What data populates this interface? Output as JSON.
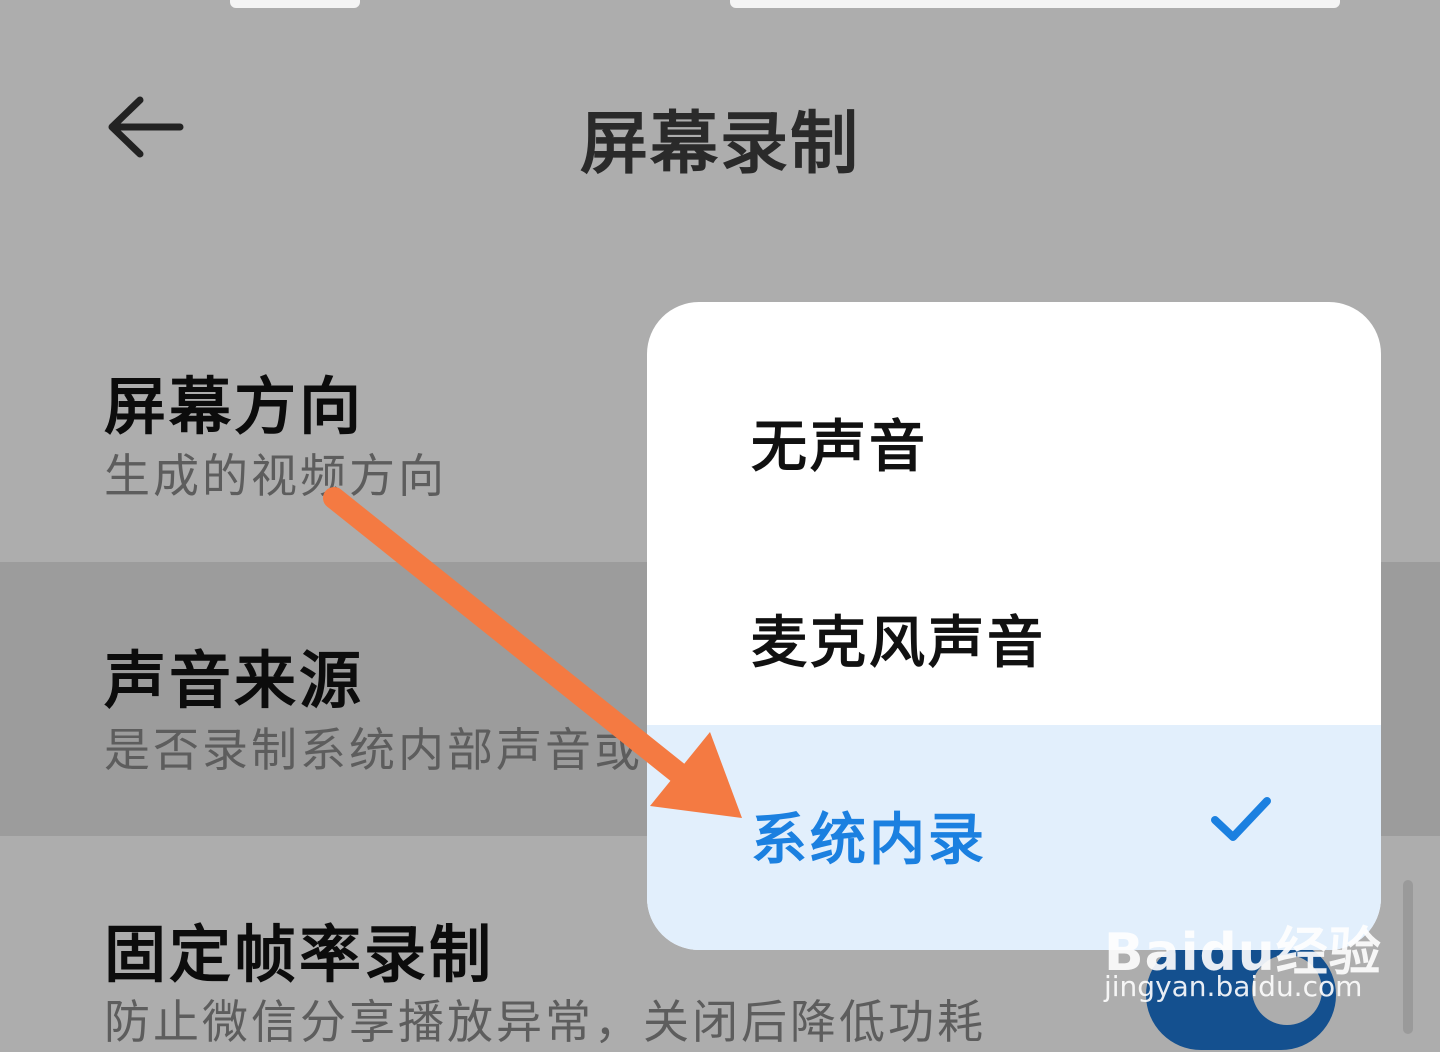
{
  "header": {
    "title": "屏幕录制",
    "back_icon": "back-arrow-icon"
  },
  "settings": [
    {
      "title": "屏幕方向",
      "subtitle": "生成的视频方向"
    },
    {
      "title": "声音来源",
      "subtitle": "是否录制系统内部声音或"
    },
    {
      "title": "固定帧率录制",
      "subtitle": "防止微信分享播放异常，关闭后降低功耗"
    }
  ],
  "popup": {
    "options": [
      {
        "label": "无声音",
        "selected": false
      },
      {
        "label": "麦克风声音",
        "selected": false
      },
      {
        "label": "系统内录",
        "selected": true
      }
    ],
    "selected_color": "#1b80e0",
    "selected_bg": "#e2effc",
    "check_icon": "check-icon"
  },
  "toggle": {
    "fixed_framerate_on": true,
    "color": "#14508f"
  },
  "annotation": {
    "arrow_color": "#f47a42"
  },
  "watermark": {
    "logo": "Baidu经验",
    "url": "jingyan.baidu.com"
  }
}
